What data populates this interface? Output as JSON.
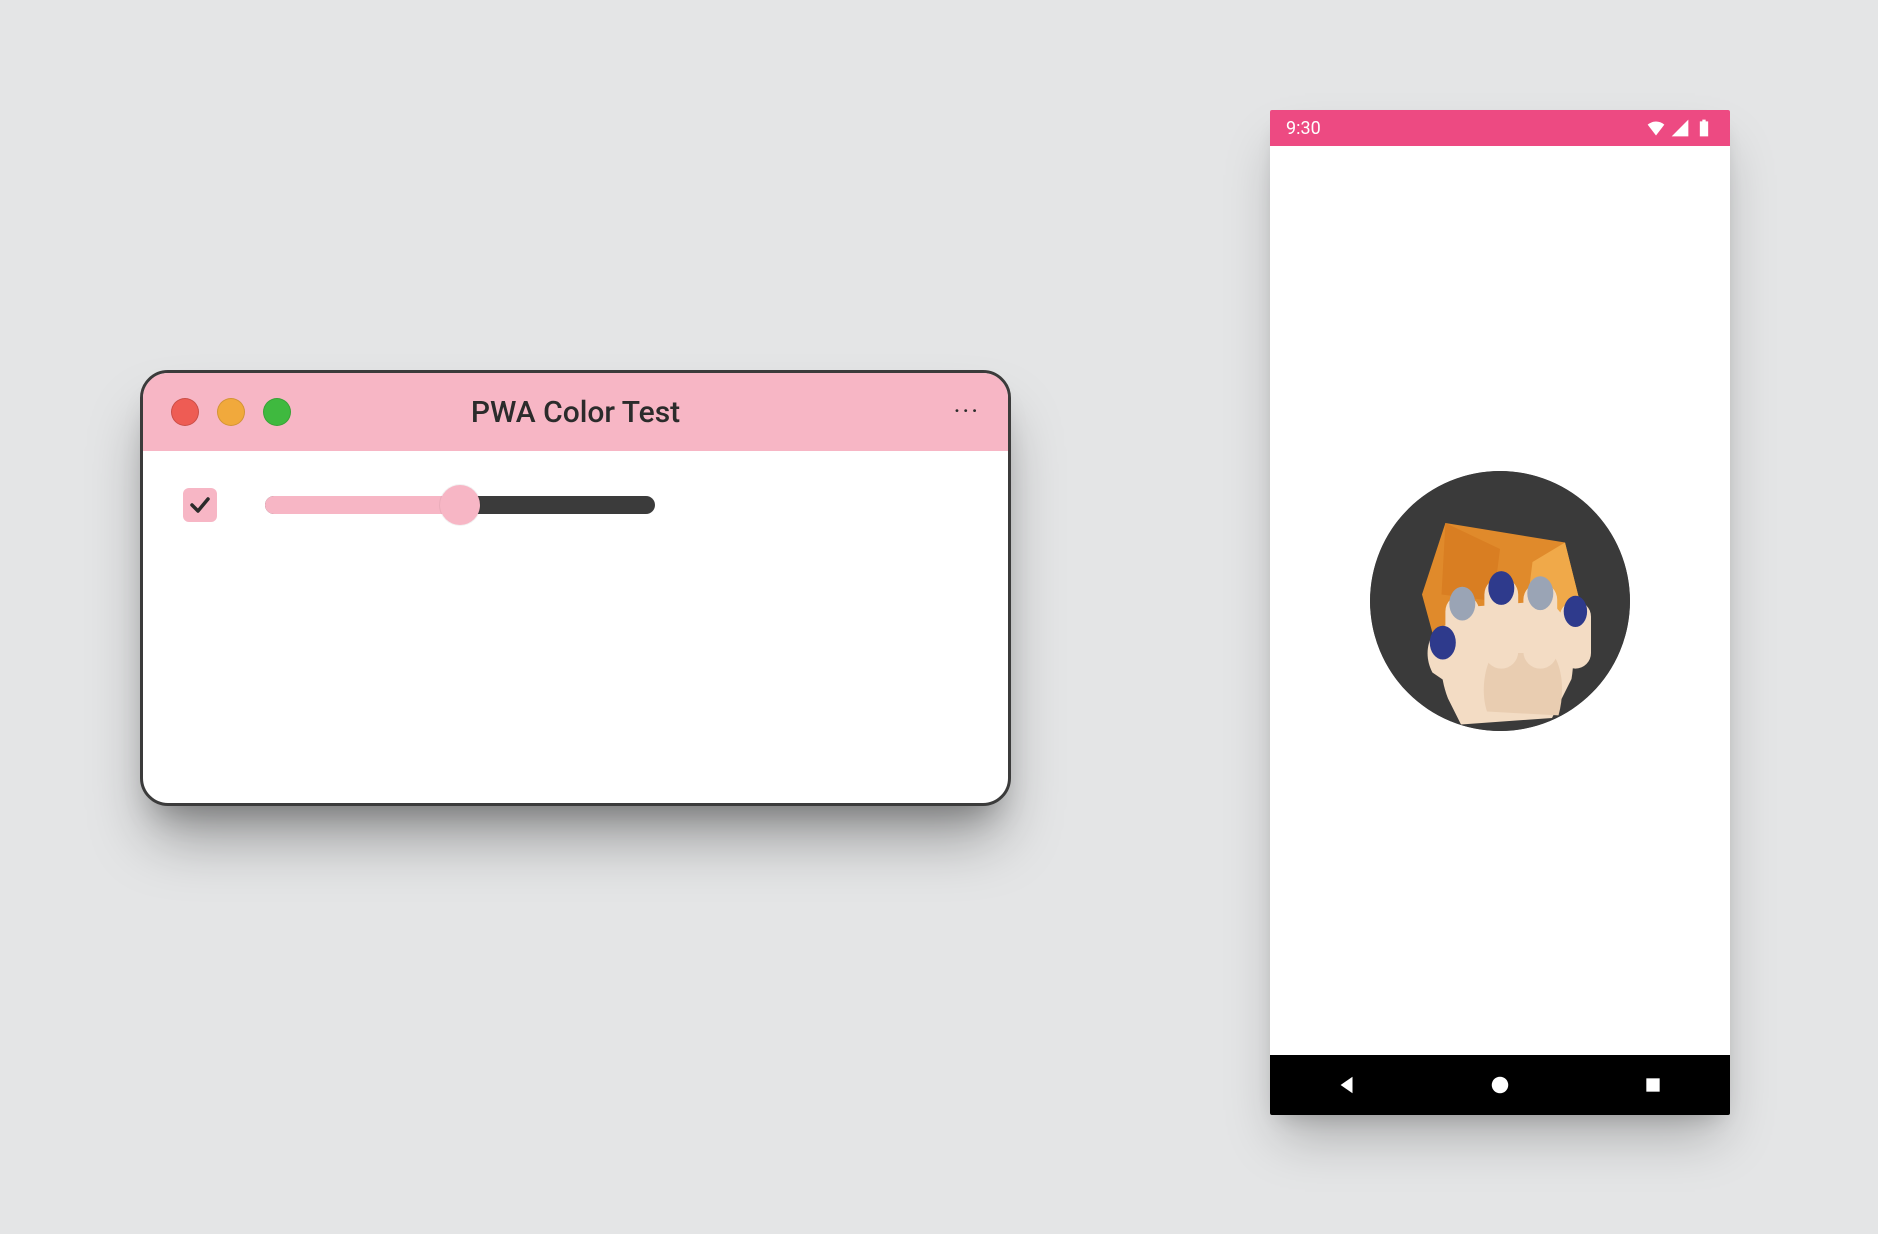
{
  "colors": {
    "accent_pink": "#f7b6c5",
    "status_pink": "#ed4a82",
    "dark": "#3b3b3b",
    "icon_bg": "#3a3a3a"
  },
  "mac": {
    "title": "PWA Color Test",
    "menu_glyph": "···",
    "checkbox_checked": true,
    "slider_percent": 50
  },
  "phone": {
    "time": "9:30",
    "icons": {
      "wifi": "wifi-icon",
      "signal": "signal-icon",
      "battery": "battery-icon"
    },
    "app_icon_name": "squoosh-app-icon"
  }
}
